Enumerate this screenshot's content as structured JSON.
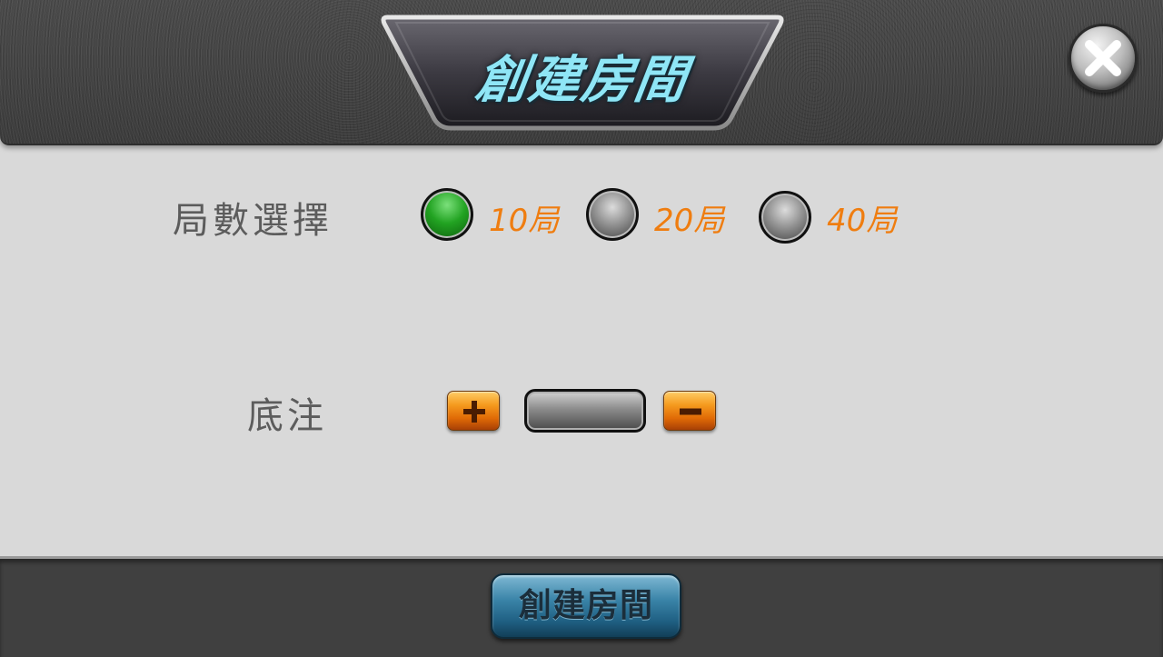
{
  "dialog": {
    "title": "創建房間",
    "close_icon": "close-x-icon"
  },
  "rounds": {
    "label": "局數選擇",
    "options": [
      {
        "label": "10局",
        "selected": true
      },
      {
        "label": "20局",
        "selected": false
      },
      {
        "label": "40局",
        "selected": false
      }
    ]
  },
  "base_bet": {
    "label": "底注",
    "value": "",
    "increment_icon": "plus-icon",
    "decrement_icon": "minus-icon"
  },
  "footer": {
    "create_button_label": "創建房間"
  },
  "colors": {
    "option_label": "#ef7d10",
    "title_text": "#8fe6f6",
    "selected_radio": "#22a322",
    "panel_background": "#d9d9d9"
  }
}
